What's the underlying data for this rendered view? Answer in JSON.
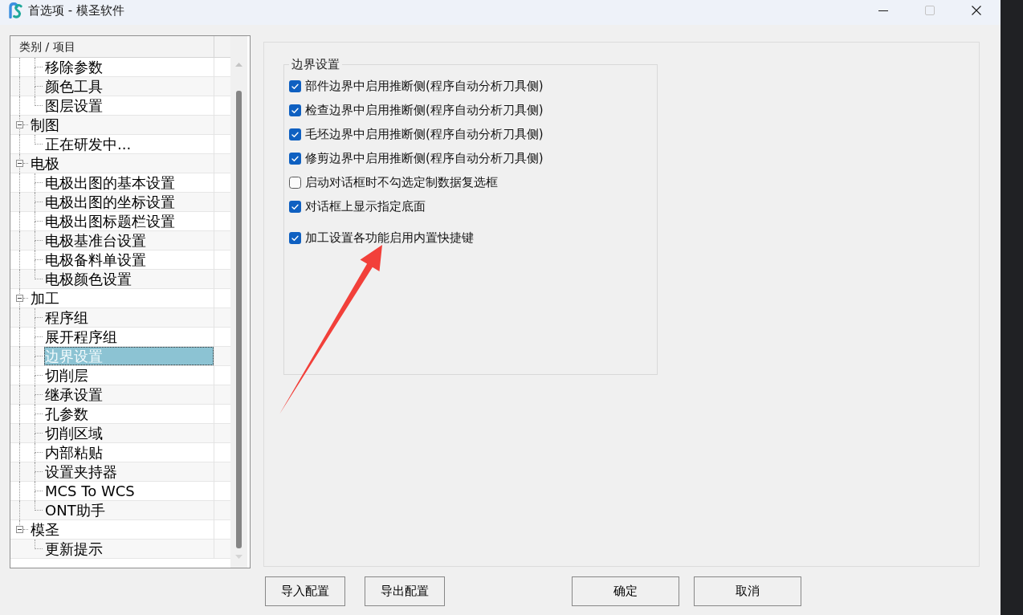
{
  "window": {
    "title": "首选项 - 模圣软件",
    "controls": [
      {
        "kind": "minimize",
        "disabled": false
      },
      {
        "kind": "maximize",
        "disabled": true
      },
      {
        "kind": "close",
        "disabled": false
      }
    ]
  },
  "tree": {
    "header": "类别 / 项目",
    "items": [
      {
        "children": [
          {
            "label": "移除参数",
            "selected": false
          },
          {
            "label": "颜色工具",
            "selected": false
          },
          {
            "label": "图层设置",
            "selected": false
          }
        ]
      },
      {
        "label": "制图",
        "selected": false,
        "expanded": true,
        "children": [
          {
            "label": "正在研发中...",
            "selected": false
          }
        ]
      },
      {
        "label": "电极",
        "selected": false,
        "expanded": true,
        "children": [
          {
            "label": "电极出图的基本设置",
            "selected": false
          },
          {
            "label": "电极出图的坐标设置",
            "selected": false
          },
          {
            "label": "电极出图标题栏设置",
            "selected": false
          },
          {
            "label": "电极基准台设置",
            "selected": false
          },
          {
            "label": "电极备料单设置",
            "selected": false
          },
          {
            "label": "电极颜色设置",
            "selected": false
          }
        ]
      },
      {
        "label": "加工",
        "selected": false,
        "expanded": true,
        "children": [
          {
            "label": "程序组",
            "selected": false
          },
          {
            "label": "展开程序组",
            "selected": false
          },
          {
            "label": "边界设置",
            "selected": true
          },
          {
            "label": "切削层",
            "selected": false
          },
          {
            "label": "继承设置",
            "selected": false
          },
          {
            "label": "孔参数",
            "selected": false
          },
          {
            "label": "切削区域",
            "selected": false
          },
          {
            "label": "内部粘贴",
            "selected": false
          },
          {
            "label": "设置夹持器",
            "selected": false
          },
          {
            "label": "MCS To WCS",
            "selected": false
          },
          {
            "label": "ONT助手",
            "selected": false
          }
        ]
      },
      {
        "label": "模圣",
        "selected": false,
        "expanded": true,
        "children": [
          {
            "label": "更新提示",
            "selected": false
          }
        ]
      }
    ]
  },
  "settings": {
    "group_title": "边界设置",
    "options": [
      {
        "label": "部件边界中启用推断侧(程序自动分析刀具侧)",
        "checked": true
      },
      {
        "label": "检查边界中启用推断侧(程序自动分析刀具侧)",
        "checked": true
      },
      {
        "label": "毛坯边界中启用推断侧(程序自动分析刀具侧)",
        "checked": true
      },
      {
        "label": "修剪边界中启用推断侧(程序自动分析刀具侧)",
        "checked": true
      },
      {
        "label": "启动对话框时不勾选定制数据复选框",
        "checked": false
      },
      {
        "label": "对话框上显示指定底面",
        "checked": true
      },
      {
        "label": "加工设置各功能启用内置快捷键",
        "checked": true
      }
    ]
  },
  "footer": {
    "config_buttons": [
      "导入配置",
      "导出配置"
    ],
    "dialog_buttons": [
      "确定",
      "取消"
    ]
  }
}
